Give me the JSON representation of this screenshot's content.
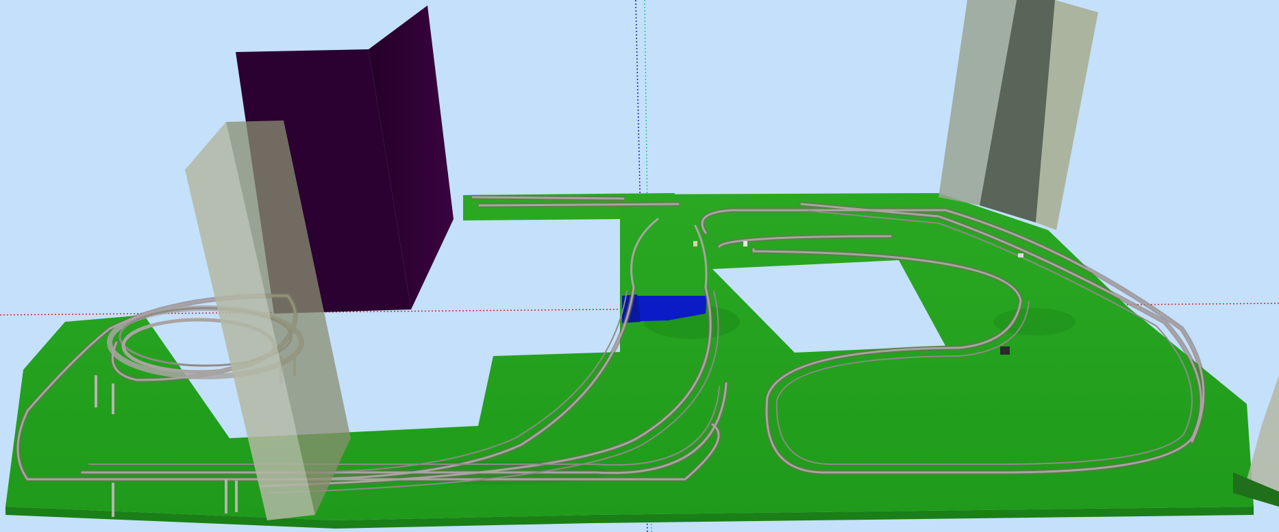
{
  "viewport": {
    "background_color": "#c4e0fb",
    "view": "perspective-3d"
  },
  "colors": {
    "baseboard": "#25a51f",
    "baseboard_dark": "#1c8c1a",
    "track_rail": "#9a9593",
    "track_ties": "#7a6664",
    "water": "#0b1cc6",
    "building_dark": "#2b0130",
    "building_light": "#b3b7a3",
    "axis_x": "#d12020",
    "axis_y": "#26c486",
    "axis_z": "#1a1a9a"
  },
  "scene_objects": [
    {
      "name": "baseboard",
      "icon": "terrain"
    },
    {
      "name": "track-layout",
      "icon": "railway-track"
    },
    {
      "name": "helix",
      "icon": "spiral-track"
    },
    {
      "name": "river",
      "icon": "water"
    },
    {
      "name": "tall-building-dark",
      "icon": "building"
    },
    {
      "name": "tall-building-light-left",
      "icon": "building"
    },
    {
      "name": "tall-building-light-right",
      "icon": "building"
    },
    {
      "name": "building-edge-right",
      "icon": "building"
    }
  ]
}
